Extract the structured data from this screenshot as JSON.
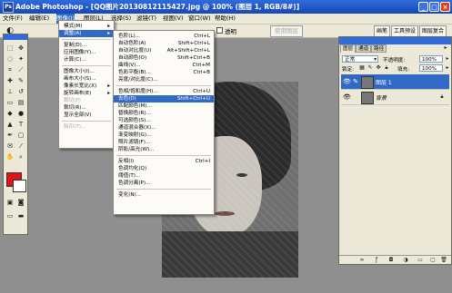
{
  "window": {
    "title": "Adobe Photoshop - [QQ图片20130812115427.jpg @ 100% (图层 1, RGB/8#)]",
    "app_icon": "Ps",
    "buttons": [
      "_",
      "□",
      "×"
    ]
  },
  "menubar": {
    "items": [
      "文件(F)",
      "编辑(E)",
      "图像(I)",
      "图层(L)",
      "选择(S)",
      "滤镜(T)",
      "视图(V)",
      "窗口(W)",
      "帮助(H)"
    ],
    "active_index": 2
  },
  "options_bar": {
    "checkbox_label": "透明",
    "disabled_button": "使用图层",
    "palette_tabs": [
      "画笔",
      "工具预设",
      "图层复合"
    ]
  },
  "image_menu": {
    "items": [
      {
        "label": "模式(M)",
        "submenu": true
      },
      {
        "label": "调整(A)",
        "submenu": true,
        "selected": true
      },
      {
        "label": "复制(D)..."
      },
      {
        "label": "应用图像(Y)..."
      },
      {
        "label": "计算(C)..."
      },
      {
        "label": "图像大小(I)..."
      },
      {
        "label": "画布大小(S)..."
      },
      {
        "label": "像素长宽比(X)",
        "submenu": true
      },
      {
        "label": "旋转画布(E)",
        "submenu": true
      },
      {
        "label": "裁切(P)",
        "disabled": true
      },
      {
        "label": "裁切(R)..."
      },
      {
        "label": "显示全部(V)"
      },
      {
        "label": "陷印(T)...",
        "disabled": true
      }
    ]
  },
  "adjust_menu": {
    "items": [
      {
        "label": "色阶(L)...",
        "shortcut": "Ctrl+L"
      },
      {
        "label": "自动色阶(A)",
        "shortcut": "Shift+Ctrl+L"
      },
      {
        "label": "自动对比度(U)",
        "shortcut": "Alt+Shift+Ctrl+L"
      },
      {
        "label": "自动颜色(O)",
        "shortcut": "Shift+Ctrl+B"
      },
      {
        "label": "曲线(V)...",
        "shortcut": "Ctrl+M"
      },
      {
        "label": "色彩平衡(B)...",
        "shortcut": "Ctrl+B"
      },
      {
        "label": "亮度/对比度(C)...",
        "shortcut": ""
      },
      {
        "label": "色相/饱和度(H)...",
        "shortcut": "Ctrl+U"
      },
      {
        "label": "去色(D)",
        "shortcut": "Shift+Ctrl+U",
        "selected": true
      },
      {
        "label": "匹配颜色(M)...",
        "shortcut": ""
      },
      {
        "label": "替换颜色(R)...",
        "shortcut": ""
      },
      {
        "label": "可选颜色(S)...",
        "shortcut": ""
      },
      {
        "label": "通道混合器(X)...",
        "shortcut": ""
      },
      {
        "label": "渐变映射(G)...",
        "shortcut": ""
      },
      {
        "label": "照片滤镜(F)...",
        "shortcut": ""
      },
      {
        "label": "阴影/高光(W)...",
        "shortcut": ""
      },
      {
        "label": "反相(I)",
        "shortcut": "Ctrl+I"
      },
      {
        "label": "色调均化(Q)",
        "shortcut": ""
      },
      {
        "label": "阈值(T)...",
        "shortcut": ""
      },
      {
        "label": "色调分离(P)...",
        "shortcut": ""
      },
      {
        "label": "变化(N)...",
        "shortcut": ""
      }
    ]
  },
  "layers_panel": {
    "tabs": [
      "图层",
      "通道",
      "路径"
    ],
    "blend_mode": "正常",
    "opacity_label": "不透明度:",
    "opacity_value": "100%",
    "lock_label": "锁定:",
    "fill_label": "填充:",
    "fill_value": "100%",
    "layers": [
      {
        "name": "图层 1",
        "selected": true
      },
      {
        "name": "背景",
        "selected": false
      }
    ]
  },
  "colors": {
    "foreground": "#e0141a",
    "background": "#ffffff",
    "accent": "#316ac5"
  }
}
